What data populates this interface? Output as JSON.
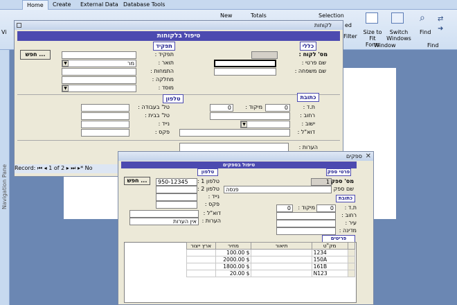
{
  "ribbon": {
    "tabs": [
      "Home",
      "Create",
      "External Data",
      "Database Tools"
    ],
    "new_label": "New",
    "totals_label": "Totals",
    "selection_label": "Selection",
    "advanced_label": "ed",
    "filter_group": "Filter",
    "size_to_fit_label": "Size to Fit Form",
    "switch_windows_label": "Switch Windows",
    "window_group": "Window",
    "find_label": "Find",
    "find_group": "Find",
    "views_label": "Vi"
  },
  "nav_pane_label": "Navigation Pane",
  "customers_window": {
    "title": "לקוחות",
    "header": "טיפול בלקוחות",
    "sections": {
      "general": "כללי",
      "role": "תפקיד",
      "address": "כתובת",
      "phone": "טלפון"
    },
    "labels": {
      "customer_no": "מס' לקוח :",
      "first_name": "שם פרטי :",
      "last_name": "שם משפחה :",
      "role": "תפקיד :",
      "title": "תואר :",
      "specialty": "התמחות :",
      "department": "מחלקה :",
      "institution": "מוסד :",
      "zip_po": "ת.ד :",
      "zip": "מיקוד :",
      "street": "רחוב :",
      "city": "ישוב :",
      "email": "דוא\"ל :",
      "work_phone": "טל' בעבודה :",
      "home_phone": "טל' בבית :",
      "mobile": "נייד :",
      "fax": "פקס :",
      "notes": "הערות :"
    },
    "values": {
      "title": "מר",
      "po_box": "0",
      "zip": "0"
    },
    "search_button": "חפש ...",
    "record_nav": {
      "label": "Record:",
      "position": "1 of 2",
      "no_filter": "No"
    }
  },
  "suppliers_window": {
    "title": "ספקים",
    "header": "טיפול בספקים",
    "sections": {
      "supplier_details": "פרטי ספק",
      "phone": "טלפון",
      "address": "כתובת",
      "supplier_items": "פריטים שמספק"
    },
    "labels": {
      "supplier_no": "מס' ספק :",
      "supplier_name": "שם ספק :",
      "phone1": "טלפון 1 :",
      "phone2": "טלפון 2 :",
      "mobile": "נייד :",
      "fax": "פקס :",
      "email": "דוא\"ל :",
      "notes": "הערות :",
      "po_box": "ת.ד :",
      "zip": "מיקוד :",
      "street": "רחוב :",
      "city": "עיר :",
      "country": "מדינה :"
    },
    "values": {
      "supplier_no": "1",
      "supplier_name": "פנסה",
      "phone1": "950-12345",
      "notes": "אין הערות",
      "po_box": "0",
      "zip": "0"
    },
    "search_button": "חפש ...",
    "items_table": {
      "columns": [
        "מק\"ט",
        "תיאור",
        "מחיר",
        "ארץ ייצור"
      ],
      "rows": [
        [
          "1234",
          "",
          "100.00 $",
          ""
        ],
        [
          "150A",
          "",
          "2000.00 $",
          ""
        ],
        [
          "161B",
          "",
          "1800.00 $",
          ""
        ],
        [
          "N123",
          "",
          "20.00 $",
          ""
        ]
      ]
    }
  }
}
